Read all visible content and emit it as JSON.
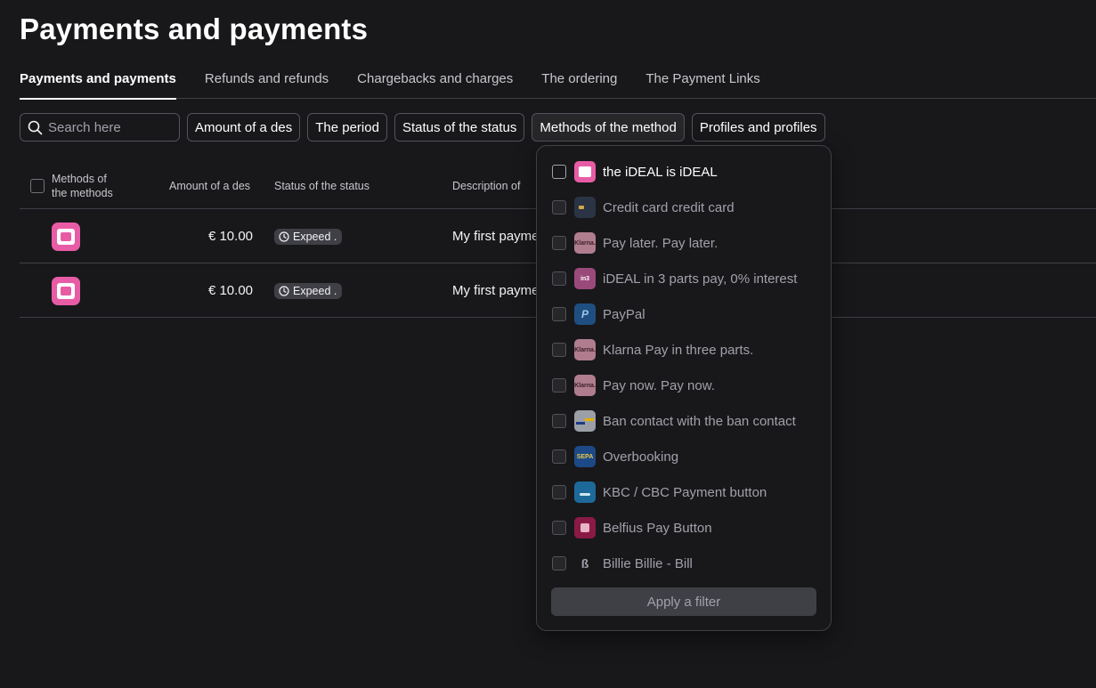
{
  "page": {
    "title": "Payments and payments"
  },
  "tabs": [
    {
      "label": "Payments and payments",
      "active": true
    },
    {
      "label": "Refunds and refunds"
    },
    {
      "label": "Chargebacks and charges"
    },
    {
      "label": "The ordering"
    },
    {
      "label": "The Payment Links"
    }
  ],
  "filters": {
    "search_placeholder": "Search here",
    "amount": "Amount of a des",
    "period": "The period",
    "status": "Status of the status",
    "methods": "Methods of the method",
    "profiles": "Profiles and profiles"
  },
  "table": {
    "headers": {
      "method_line1": "Methods of",
      "method_line2": "the methods",
      "amount": "Amount of a des",
      "status": "Status of the status",
      "description": "Description of"
    },
    "rows": [
      {
        "method_icon": "ideal-icon",
        "amount": "€ 10.00",
        "status": "Expeed .",
        "description": "My first payme"
      },
      {
        "method_icon": "ideal-icon",
        "amount": "€ 10.00",
        "status": "Expeed .",
        "description": "My first payme"
      }
    ]
  },
  "dropdown": {
    "options": [
      {
        "label": "the iDEAL is iDEAL",
        "icon": "ideal-icon",
        "color": "#e85ca6",
        "active": true
      },
      {
        "label": "Credit card credit card",
        "icon": "credit-card-icon",
        "color": "#2b3444"
      },
      {
        "label": "Pay later. Pay later.",
        "icon": "klarna-icon",
        "color": "#b07d8e"
      },
      {
        "label": "iDEAL in 3 parts pay, 0% interest",
        "icon": "ideal-in3-icon",
        "color": "#9a4a7a"
      },
      {
        "label": "PayPal",
        "icon": "paypal-icon",
        "color": "#1f4f80"
      },
      {
        "label": "Klarna Pay in three parts.",
        "icon": "klarna-icon",
        "color": "#b07d8e"
      },
      {
        "label": "Pay now. Pay now.",
        "icon": "klarna-icon",
        "color": "#b07d8e"
      },
      {
        "label": "Ban contact with the ban contact",
        "icon": "bancontact-icon",
        "color": "#9aa0a6"
      },
      {
        "label": "Overbooking",
        "icon": "sepa-icon",
        "color": "#1d4a86"
      },
      {
        "label": "KBC / CBC Payment button",
        "icon": "kbc-icon",
        "color": "#1d6a9a"
      },
      {
        "label": "Belfius Pay Button",
        "icon": "belfius-icon",
        "color": "#8a1a45"
      },
      {
        "label": "Billie Billie - Bill",
        "icon": "billie-icon",
        "color": "#18181b"
      }
    ],
    "apply_label": "Apply a filter"
  }
}
